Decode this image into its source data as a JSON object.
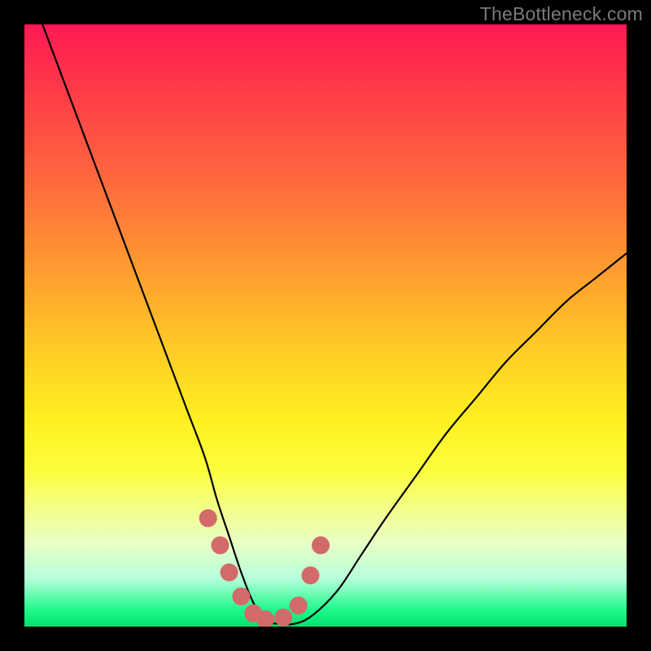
{
  "watermark": "TheBottleneck.com",
  "colors": {
    "background": "#000000",
    "curve_stroke": "#000000",
    "marker_fill": "#d36a6a",
    "marker_stroke": "#d36a6a"
  },
  "chart_data": {
    "type": "line",
    "title": "",
    "xlabel": "",
    "ylabel": "",
    "xlim": [
      0,
      100
    ],
    "ylim": [
      0,
      100
    ],
    "grid": false,
    "legend": false,
    "note": "No axis ticks or labels visible; values are geometric estimates of the curve shape.",
    "series": [
      {
        "name": "bottleneck-curve",
        "x": [
          3,
          6,
          9,
          12,
          15,
          18,
          21,
          24,
          27,
          30,
          32,
          34,
          36,
          38,
          40,
          42,
          45,
          48,
          52,
          56,
          60,
          65,
          70,
          75,
          80,
          85,
          90,
          95,
          100
        ],
        "y": [
          100,
          92,
          84,
          76,
          68,
          60,
          52,
          44,
          36,
          28,
          21,
          15,
          9,
          4,
          1,
          0.5,
          0.5,
          2,
          6,
          12,
          18,
          25,
          32,
          38,
          44,
          49,
          54,
          58,
          62
        ]
      }
    ],
    "markers": {
      "name": "valley-markers",
      "x": [
        30.5,
        32.5,
        34.0,
        36.0,
        38.0,
        40.0,
        43.0,
        45.5,
        47.5,
        49.2
      ],
      "y": [
        18.0,
        13.5,
        9.0,
        5.0,
        2.2,
        1.2,
        1.5,
        3.5,
        8.5,
        13.5
      ]
    }
  }
}
